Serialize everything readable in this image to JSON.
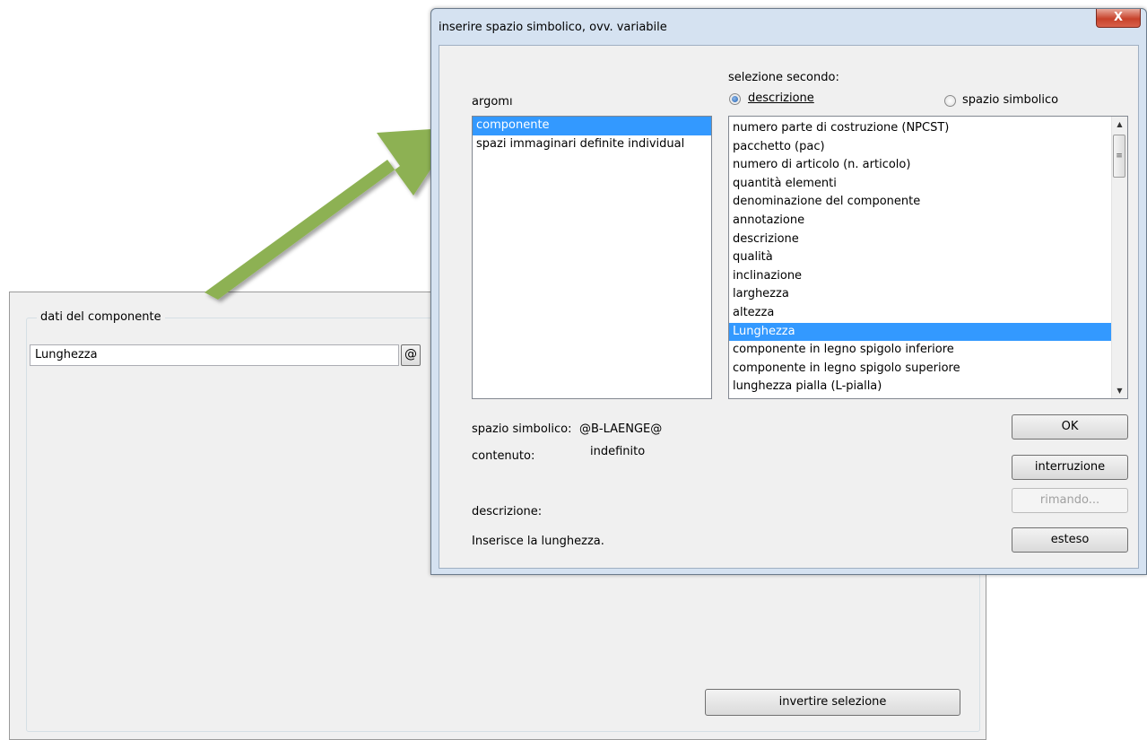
{
  "background_panel": {
    "group_title": "dati del componente",
    "field_value": "Lunghezza",
    "at_button": "@",
    "invert_button": "invertire selezione"
  },
  "dialog": {
    "title": "inserire spazio simbolico, ovv. variabile",
    "close_glyph": "X",
    "selection_label": "selezione secondo:",
    "radio_description": "descrizione",
    "radio_symbolic": "spazio simbolico",
    "argument_label": "argomı",
    "arguments": [
      {
        "label": "componente",
        "selected": true
      },
      {
        "label": "spazi immaginari definite individual",
        "selected": false
      }
    ],
    "variables": [
      {
        "label": "numero parte di costruzione (NPCST)",
        "selected": false
      },
      {
        "label": "pacchetto (pac)",
        "selected": false
      },
      {
        "label": "numero di articolo (n. articolo)",
        "selected": false
      },
      {
        "label": "quantità elementi",
        "selected": false
      },
      {
        "label": "denominazione del componente",
        "selected": false
      },
      {
        "label": "annotazione",
        "selected": false
      },
      {
        "label": "descrizione",
        "selected": false
      },
      {
        "label": "qualità",
        "selected": false
      },
      {
        "label": "inclinazione",
        "selected": false
      },
      {
        "label": "larghezza",
        "selected": false
      },
      {
        "label": "altezza",
        "selected": false
      },
      {
        "label": "Lunghezza",
        "selected": true
      },
      {
        "label": "componente in legno spigolo inferiore",
        "selected": false
      },
      {
        "label": "componente in legno spigolo superiore",
        "selected": false
      },
      {
        "label": "lunghezza pialla (L-pialla)",
        "selected": false
      }
    ],
    "symbolic_space_label": "spazio simbolico:",
    "symbolic_space_value": "@B-LAENGE@",
    "content_label": "contenuto:",
    "content_value": "indefinito",
    "description_label": "descrizione:",
    "description_value": "Inserisce la lunghezza.",
    "buttons": {
      "ok": "OK",
      "interrupt": "interruzione",
      "reference": "rimando...",
      "extended": "esteso"
    }
  },
  "colors": {
    "arrow": "#8db152",
    "selection": "#3399ff",
    "dialog_frame": "#d5e2f1",
    "close_button": "#c7422b"
  }
}
